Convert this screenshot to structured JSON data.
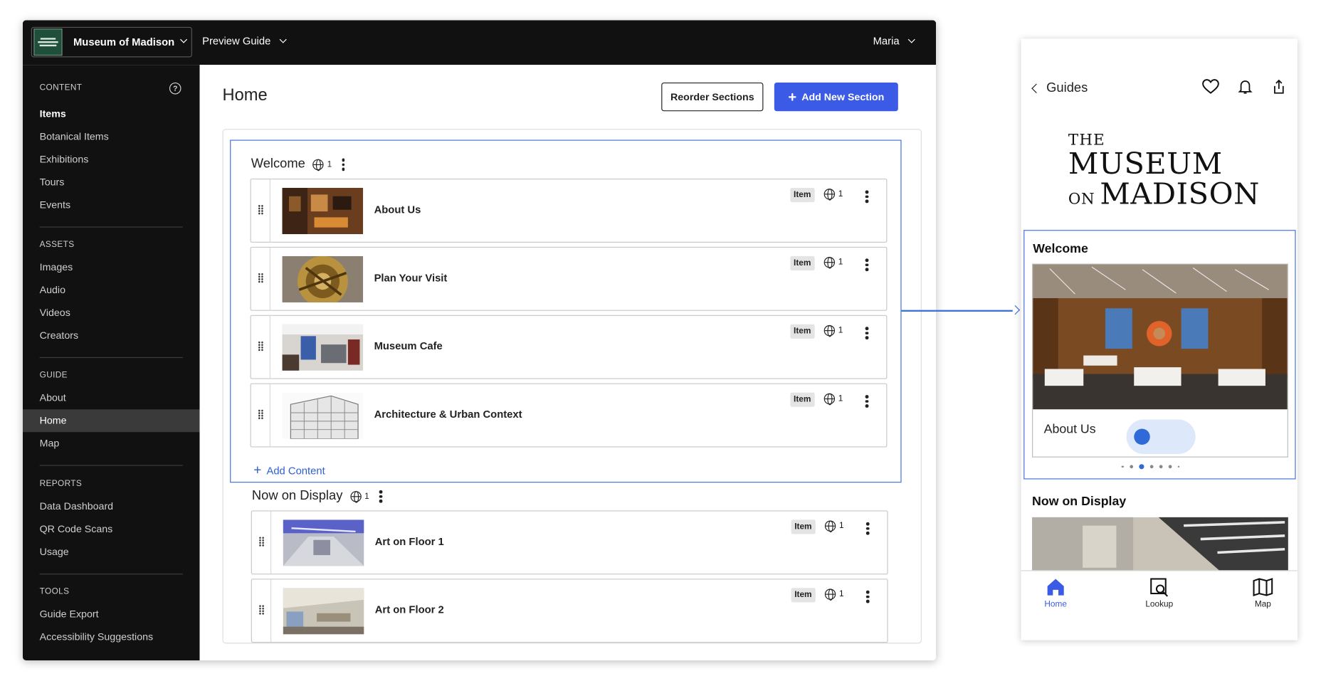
{
  "topbar": {
    "org_name": "Museum of Madison",
    "preview_guide": "Preview Guide",
    "user": "Maria"
  },
  "sidebar": {
    "sections": [
      {
        "header": "CONTENT",
        "items": [
          "Items",
          "Botanical Items",
          "Exhibitions",
          "Tours",
          "Events"
        ]
      },
      {
        "header": "ASSETS",
        "items": [
          "Images",
          "Audio",
          "Videos",
          "Creators"
        ]
      },
      {
        "header": "GUIDE",
        "items": [
          "About",
          "Home",
          "Map"
        ]
      },
      {
        "header": "REPORTS",
        "items": [
          "Data Dashboard",
          "QR Code Scans",
          "Usage"
        ]
      },
      {
        "header": "TOOLS",
        "items": [
          "Guide Export",
          "Accessibility Suggestions"
        ]
      }
    ],
    "active_item": "Home",
    "bold_item": "Items"
  },
  "main": {
    "title": "Home",
    "reorder_label": "Reorder Sections",
    "add_section_label": "Add New Section",
    "add_content_label": "Add Content",
    "sections": [
      {
        "title": "Welcome",
        "language_count": "1",
        "rows": [
          {
            "title": "About Us",
            "tag": "Item",
            "language_count": "1"
          },
          {
            "title": "Plan Your Visit",
            "tag": "Item",
            "language_count": "1"
          },
          {
            "title": "Museum Cafe",
            "tag": "Item",
            "language_count": "1"
          },
          {
            "title": "Architecture & Urban Context",
            "tag": "Item",
            "language_count": "1"
          }
        ]
      },
      {
        "title": "Now on Display",
        "language_count": "1",
        "rows": [
          {
            "title": "Art on Floor 1",
            "tag": "Item",
            "language_count": "1"
          },
          {
            "title": "Art on Floor 2",
            "tag": "Item",
            "language_count": "1"
          }
        ]
      }
    ]
  },
  "phone": {
    "back_label": "Guides",
    "logo_line1": "THE",
    "logo_line2": "MUSEUM",
    "logo_on": "ON",
    "logo_line3": "MADISON",
    "welcome_title": "Welcome",
    "card_title": "About Us",
    "now_title": "Now on Display",
    "carousel_pages": 7,
    "carousel_active": 3,
    "tabs": [
      "Home",
      "Lookup",
      "Map"
    ],
    "active_tab": "Home"
  },
  "colors": {
    "accent": "#3b5be6",
    "frame_blue": "#3f73d8",
    "sidebar_bg": "#111111",
    "active_bg": "#3a3a3a"
  }
}
